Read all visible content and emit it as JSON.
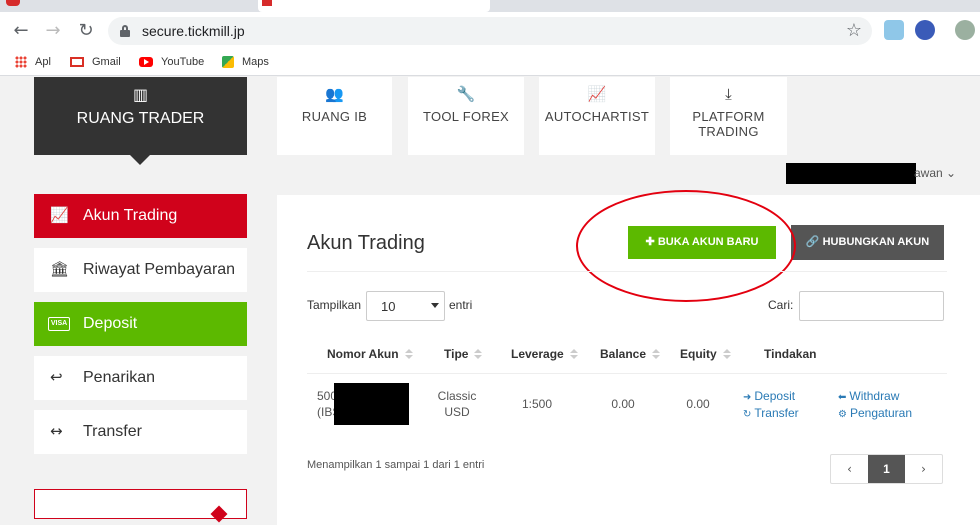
{
  "browser": {
    "url": "secure.tickmill.jp",
    "bookmarks": [
      "Apl",
      "Gmail",
      "YouTube",
      "Maps"
    ]
  },
  "nav": {
    "active": "RUANG TRADER",
    "cards": [
      "RUANG IB",
      "TOOL FOREX",
      "AUTOCHARTIST",
      "PLATFORM TRADING"
    ]
  },
  "user_menu_suffix": "awan",
  "sidebar": {
    "items": [
      {
        "label": "Akun Trading",
        "icon": "chart-line-icon",
        "color": "#d0021b"
      },
      {
        "label": "Riwayat Pembayaran",
        "icon": "bank-icon"
      },
      {
        "label": "Deposit",
        "icon": "visa-card-icon",
        "color": "#5cb900"
      },
      {
        "label": "Penarikan",
        "icon": "reply-icon"
      },
      {
        "label": "Transfer",
        "icon": "arrows-horizontal-icon"
      }
    ]
  },
  "panel": {
    "title": "Akun Trading",
    "btn_new": "BUKA AKUN BARU",
    "btn_link": "HUBUNGKAN AKUN",
    "show_label": "Tampilkan",
    "page_size": "10",
    "entries_label": "entri",
    "search_label": "Cari:",
    "search_value": "",
    "columns": [
      "Nomor Akun",
      "Tipe",
      "Leverage",
      "Balance",
      "Equity",
      "Tindakan"
    ],
    "row": {
      "account_prefix": "500",
      "account_suffix": "(IBS",
      "type": "Classic USD",
      "leverage": "1:500",
      "balance": "0.00",
      "equity": "0.00",
      "actions": [
        "Deposit",
        "Transfer",
        "Withdraw",
        "Pengaturan"
      ]
    },
    "info": "Menampilkan 1 sampai 1 dari 1 entri",
    "current_page": "1"
  }
}
